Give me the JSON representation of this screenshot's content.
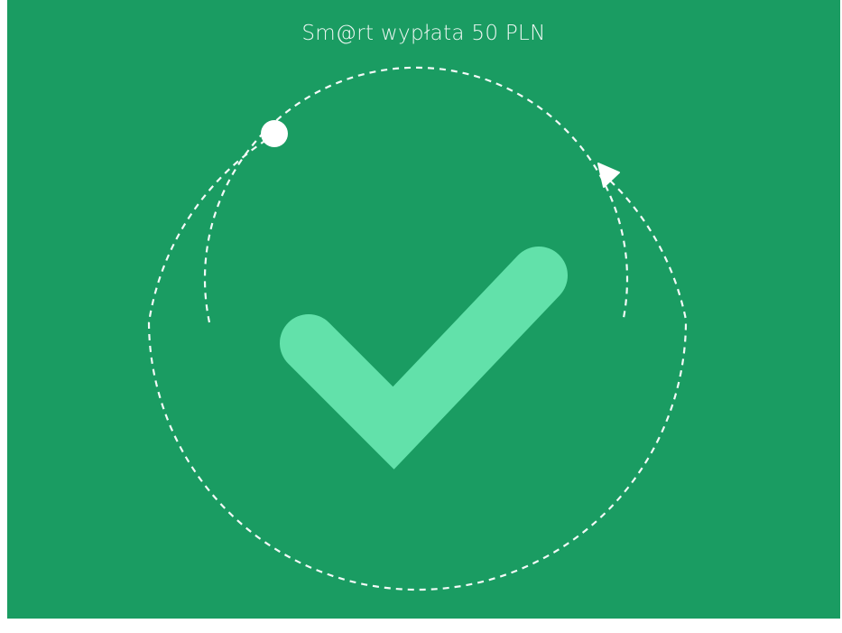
{
  "screen": {
    "title": "Sm@rt wypłata 50 PLN",
    "background_color": "#1a9c62",
    "check_color": "#62e1aa",
    "line_color": "#ffffff"
  },
  "graphics": {
    "center_icon": "checkmark-icon",
    "ring_decoration": "dashed-rings",
    "start_marker": "circle-dot-icon",
    "end_marker": "arrowhead-icon"
  }
}
